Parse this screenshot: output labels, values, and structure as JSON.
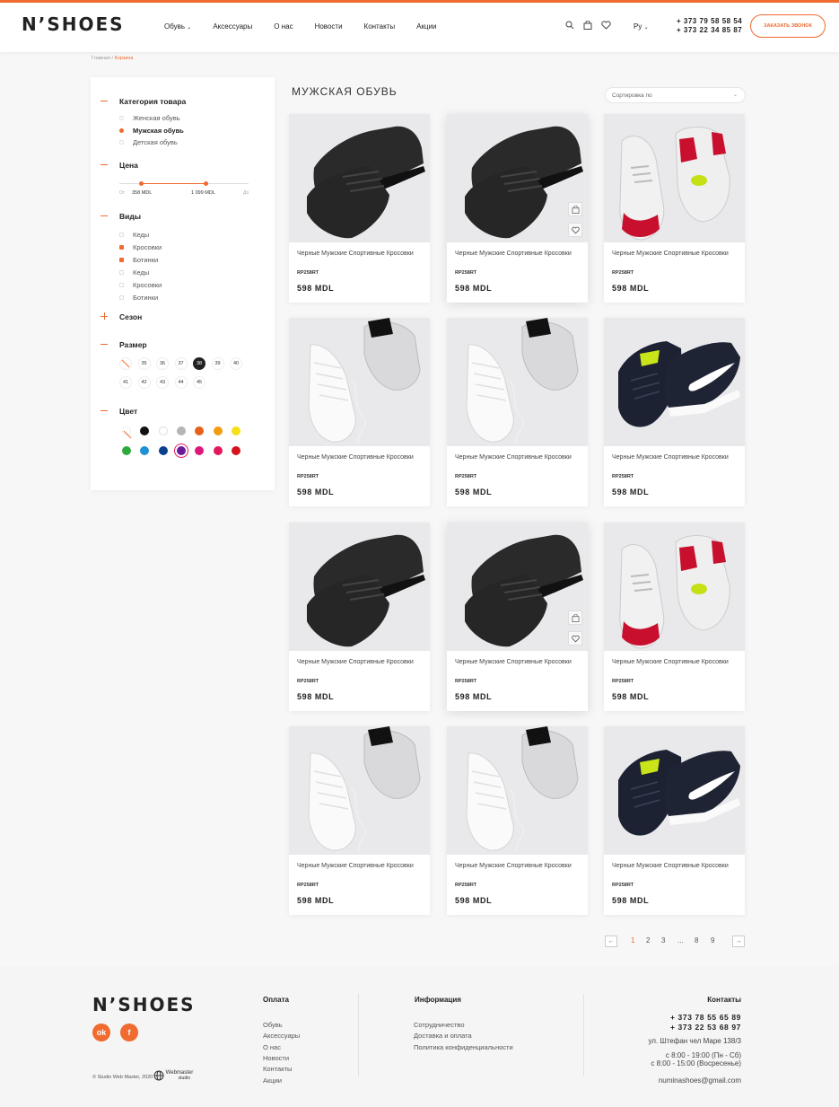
{
  "header": {
    "logo": "N’SHOES",
    "nav": [
      "Обувь",
      "Аксессуары",
      "О нас",
      "Новости",
      "Контакты",
      "Акции"
    ],
    "nav_dropdown_marker": "⌄",
    "lang": "Ру",
    "phones": [
      "+ 373 79 58 58 54",
      "+ 373 22 34 85 87"
    ],
    "call_button": "ЗАКАЗАТЬ ЗВОНОК",
    "icons": [
      "search-icon",
      "bag-icon",
      "heart-icon"
    ]
  },
  "breadcrumb": {
    "home": "Главная",
    "sep": " / ",
    "current": "Корзина"
  },
  "sidebar": {
    "category": {
      "title": "Категория товара",
      "options": [
        "Женская обувь",
        "Мужская обувь",
        "Детская обувь"
      ],
      "selected": 1
    },
    "price": {
      "title": "Цена",
      "from_label": "От",
      "to_label": "До",
      "min": "358 MDL",
      "max": "1 099 MDL",
      "range_fraction": [
        0.17,
        0.67
      ]
    },
    "types": {
      "title": "Виды",
      "options": [
        "Кеды",
        "Кросовки",
        "Ботинки",
        "Кеды",
        "Кросовки",
        "Ботинки"
      ],
      "selected": [
        1,
        2
      ]
    },
    "season": {
      "title": "Сезон"
    },
    "size": {
      "title": "Размер",
      "row1": [
        "",
        "35",
        "36",
        "37",
        "38",
        "39",
        "40"
      ],
      "row2": [
        "41",
        "42",
        "43",
        "44",
        "45"
      ],
      "selected": "38"
    },
    "color": {
      "title": "Цвет",
      "row1": [
        "none",
        "#111111",
        "#ffffff",
        "#b5b5b5",
        "#e8601c",
        "#f39c12",
        "#f7e018"
      ],
      "row2": [
        "#2eaa3c",
        "#1e90d6",
        "#0b3f8f",
        "#6a1b9a",
        "#e0177a",
        "#e2185a",
        "#d6121c"
      ],
      "selected_index": 10
    }
  },
  "main": {
    "title": "МУЖСКАЯ ОБУВЬ",
    "sort_placeholder": "Сортировка по",
    "products": [
      {
        "name": "Черные Мужские Спортивные Кросовки",
        "sku": "RP258RT",
        "price": "598 MDL",
        "img": "black",
        "hover": false
      },
      {
        "name": "Черные Мужские Спортивные Кросовки",
        "sku": "RP258RT",
        "price": "598 MDL",
        "img": "black",
        "hover": true
      },
      {
        "name": "Черные Мужские Спортивные Кросовки",
        "sku": "RP258RT",
        "price": "598 MDL",
        "img": "red",
        "hover": false
      },
      {
        "name": "Черные Мужские Спортивные Кросовки",
        "sku": "RP258RT",
        "price": "598 MDL",
        "img": "white",
        "hover": false
      },
      {
        "name": "Черные Мужские Спортивные Кросовки",
        "sku": "RP258RT",
        "price": "598 MDL",
        "img": "white",
        "hover": false
      },
      {
        "name": "Черные Мужские Спортивные Кросовки",
        "sku": "RP258RT",
        "price": "598 MDL",
        "img": "navy",
        "hover": false
      },
      {
        "name": "Черные Мужские Спортивные Кросовки",
        "sku": "RP258RT",
        "price": "598 MDL",
        "img": "black",
        "hover": false
      },
      {
        "name": "Черные Мужские Спортивные Кросовки",
        "sku": "RP258RT",
        "price": "598 MDL",
        "img": "black",
        "hover": true
      },
      {
        "name": "Черные Мужские Спортивные Кросовки",
        "sku": "RP258RT",
        "price": "598 MDL",
        "img": "red",
        "hover": false
      },
      {
        "name": "Черные Мужские Спортивные Кросовки",
        "sku": "RP258RT",
        "price": "598 MDL",
        "img": "white",
        "hover": false
      },
      {
        "name": "Черные Мужские Спортивные Кросовки",
        "sku": "RP258RT",
        "price": "598 MDL",
        "img": "white",
        "hover": false
      },
      {
        "name": "Черные Мужские Спортивные Кросовки",
        "sku": "RP258RT",
        "price": "598 MDL",
        "img": "navy",
        "hover": false
      }
    ],
    "pagination": {
      "prev": "←",
      "next": "→",
      "pages": [
        "1",
        "2",
        "3",
        "...",
        "8",
        "9"
      ],
      "current": "1"
    }
  },
  "footer": {
    "logo": "N’SHOES",
    "social": [
      "ok",
      "f"
    ],
    "copyright": "© Studio Web Master, 2020",
    "webmaster": "Webmaster",
    "webmaster_sub": "studio",
    "payment": {
      "title": "Оплата",
      "links": [
        "Обувь",
        "Аксессуары",
        "О нас",
        "Новости",
        "Контакты",
        "Акции"
      ]
    },
    "info": {
      "title": "Информация",
      "links": [
        "Сотрудничество",
        "Доставка и оплата",
        "Политика конфиденциальности"
      ]
    },
    "contacts": {
      "title": "Контакты",
      "phones": [
        "+ 373 78 55 65 89",
        "+ 373 22 53 68 97"
      ],
      "address": "ул. Штефан чел Маре 138/3",
      "hours": [
        "с 8:00 - 19:00 (Пн - Сб)",
        "с 8:00 - 15:00 (Восресенье)"
      ],
      "email": "numinashoes@gmail.com"
    }
  },
  "colors": {
    "accent": "#ef6b2f"
  }
}
